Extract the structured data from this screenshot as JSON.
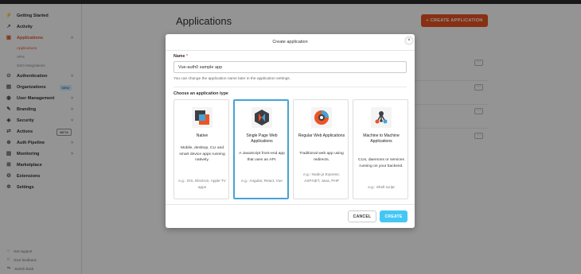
{
  "sidebar": {
    "items": [
      {
        "label": "Getting Started",
        "icon": "bolt-icon"
      },
      {
        "label": "Activity",
        "icon": "activity-icon"
      },
      {
        "label": "Applications",
        "icon": "applications-icon",
        "active": true
      },
      {
        "label": "Authentication",
        "icon": "authentication-icon"
      },
      {
        "label": "Organizations",
        "icon": "organizations-icon",
        "badge": "NEW"
      },
      {
        "label": "User Management",
        "icon": "user-icon"
      },
      {
        "label": "Branding",
        "icon": "branding-icon"
      },
      {
        "label": "Security",
        "icon": "shield-icon"
      },
      {
        "label": "Actions",
        "icon": "actions-icon",
        "badge": "BETA"
      },
      {
        "label": "Auth Pipeline",
        "icon": "pipeline-icon"
      },
      {
        "label": "Monitoring",
        "icon": "monitoring-icon"
      },
      {
        "label": "Marketplace",
        "icon": "marketplace-icon"
      },
      {
        "label": "Extensions",
        "icon": "extensions-icon"
      },
      {
        "label": "Settings",
        "icon": "gear-icon"
      }
    ],
    "subitems": [
      "Applications",
      "APIs",
      "SSO Integrations"
    ],
    "footer": [
      "Get support",
      "Give feedback",
      "Switch back"
    ]
  },
  "main": {
    "title": "Applications",
    "create_button": "+ CREATE APPLICATION"
  },
  "modal": {
    "title": "Create application",
    "name_label": "Name",
    "name_required": "*",
    "name_value": "Vue-auth0 sample app",
    "help_text": "You can change the application name later in the application settings.",
    "choose_label": "Choose an application type",
    "cards": [
      {
        "title": "Native",
        "description": "Mobile, desktop, CLI and smart device apps running natively.",
        "example": "e.g.: iOS, Electron, Apple TV apps",
        "icon": "native-icon"
      },
      {
        "title": "Single Page Web Applications",
        "description": "A JavaScript front-end app that uses an API.",
        "example": "e.g.: Angular, React, Vue",
        "icon": "spa-icon",
        "selected": true
      },
      {
        "title": "Regular Web Applications",
        "description": "Traditional web app using redirects.",
        "example": "e.g.: Node.js Express, ASP.NET, Java, PHP",
        "icon": "regular-web-icon"
      },
      {
        "title": "Machine to Machine Applications",
        "description": "CLIs, daemons or services running on your backend.",
        "example": "e.g.: Shell script",
        "icon": "m2m-icon"
      }
    ],
    "cancel_label": "CANCEL",
    "create_label": "CREATE",
    "close_symbol": "×"
  },
  "colors": {
    "accent": "#eb5424",
    "primary_button": "#44c7f4",
    "selected_border": "#44a3d6"
  }
}
